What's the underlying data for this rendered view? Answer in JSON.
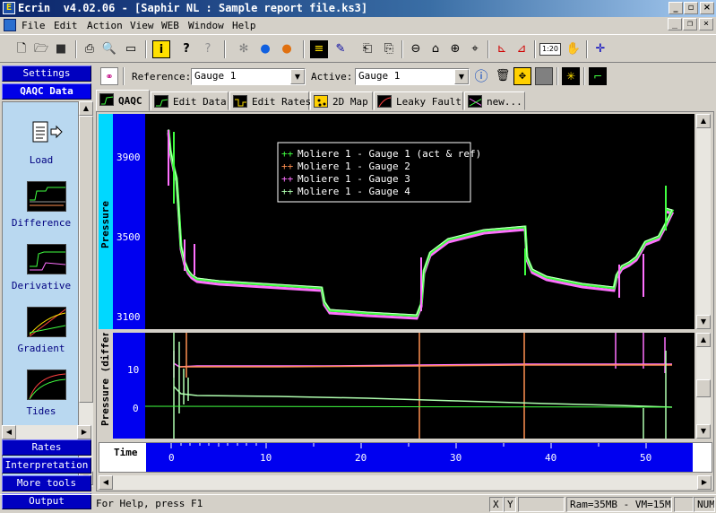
{
  "window": {
    "title": "Ecrin  v4.02.06 - [Saphir NL : Sample report file.ks3]",
    "app_icon_glyph": "E"
  },
  "menu": [
    "File",
    "Edit",
    "Action",
    "View",
    "WEB",
    "Window",
    "Help"
  ],
  "toolbar": [
    "new-file-icon",
    "open-folder-icon",
    "save-icon",
    "print-icon",
    "print-preview-icon",
    "page-setup-icon",
    "info-icon",
    "help-icon",
    "context-help-icon",
    "gear-icon",
    "blue-drop-icon",
    "orange-drop-icon",
    "list-icon",
    "pen-icon",
    "copy-plot-icon",
    "paste-plot-icon",
    "zoom-out-icon",
    "home-icon",
    "zoom-in-icon",
    "zoom-fit-icon",
    "axes-icon",
    "axes-scale-icon",
    "scale-icon",
    "pan-hand-icon",
    "cursor-target-icon"
  ],
  "toolbar_scale_label": "1:20",
  "left_panel": {
    "top_tabs": [
      "Settings",
      "QAQC Data"
    ],
    "items": [
      "Load",
      "Difference",
      "Derivative",
      "Gradient",
      "Tides"
    ],
    "bottom_tabs": [
      "Rates",
      "Interpretation",
      "More tools",
      "Output"
    ]
  },
  "reference_bar": {
    "reference_label": "Reference:",
    "reference_value": "Gauge 1",
    "active_label": "Active:",
    "active_value": "Gauge 1"
  },
  "tabs": [
    "QAQC",
    "Edit Data",
    "Edit Rates",
    "2D Map",
    "Leaky Fault",
    "new..."
  ],
  "active_tab": "QAQC",
  "colors": {
    "accent": "#00d8ff",
    "gauge1": "#40ff40",
    "gauge2": "#ff9050",
    "gauge3": "#ff70ff",
    "gauge4": "#b0ffb0"
  },
  "top_plot": {
    "ylabel": "Pressure",
    "yticks": [
      "3900",
      "3500",
      "3100"
    ],
    "legend": [
      "Moliere 1 - Gauge 1 (act & ref)",
      "Moliere 1 - Gauge 2",
      "Moliere 1 - Gauge 3",
      "Moliere 1 - Gauge 4"
    ]
  },
  "bottom_plot": {
    "ylabel": "Pressure (differen",
    "yticks": [
      "10",
      "0"
    ]
  },
  "time_axis": {
    "label": "Time",
    "ticks": [
      "0",
      "10",
      "20",
      "30",
      "40",
      "50"
    ]
  },
  "status": {
    "help_text": "For Help, press F1",
    "x_label": "X",
    "y_label": "Y",
    "memory": "Ram=35MB - VM=15MB",
    "numlock": "NUM"
  }
}
